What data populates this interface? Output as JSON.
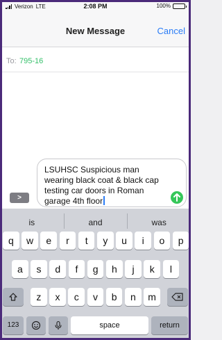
{
  "status_bar": {
    "carrier": "Verizon",
    "network": "LTE",
    "time": "2:08 PM",
    "battery_percent": "100%",
    "battery_level": 1.0
  },
  "nav": {
    "title": "New Message",
    "cancel_label": "Cancel"
  },
  "recipient": {
    "label": "To:",
    "value": "795-16"
  },
  "compose": {
    "apps_label": ">",
    "message": "LSUHSC Suspicious man wearing black coat & black cap testing car doors in Roman garage 4th floor",
    "send_icon": "arrow-up-icon"
  },
  "keyboard": {
    "suggestions": [
      "is",
      "and",
      "was"
    ],
    "row1": [
      "q",
      "w",
      "e",
      "r",
      "t",
      "y",
      "u",
      "i",
      "o",
      "p"
    ],
    "row2": [
      "a",
      "s",
      "d",
      "f",
      "g",
      "h",
      "j",
      "k",
      "l"
    ],
    "row3": [
      "z",
      "x",
      "c",
      "v",
      "b",
      "n",
      "m"
    ],
    "shift_icon": "shift-icon",
    "delete_icon": "delete-icon",
    "numbers_label": "123",
    "emoji_icon": "emoji-icon",
    "mic_icon": "microphone-icon",
    "space_label": "space",
    "return_label": "return"
  },
  "colors": {
    "accent": "#2a7cf6",
    "recipient": "#35c06a",
    "send": "#35c759",
    "frame": "#4b2a7a"
  }
}
